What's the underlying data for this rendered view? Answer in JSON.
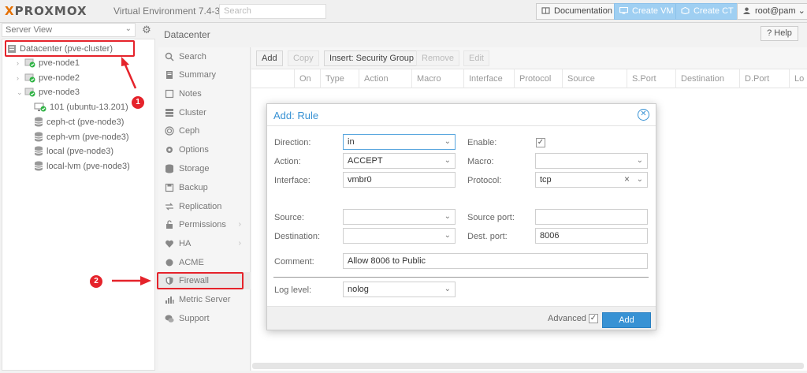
{
  "topbar": {
    "logo_x": "X",
    "logo_text": "PROXMOX",
    "version": "Virtual Environment 7.4-3",
    "search_placeholder": "Search",
    "documentation": "Documentation",
    "create_vm": "Create VM",
    "create_ct": "Create CT",
    "user": "root@pam"
  },
  "server_view": {
    "select_value": "Server View",
    "tree": [
      {
        "label": "Datacenter (pve-cluster)",
        "icon": "datacenter-icon"
      },
      {
        "label": "pve-node1",
        "icon": "node-icon"
      },
      {
        "label": "pve-node2",
        "icon": "node-icon"
      },
      {
        "label": "pve-node3",
        "icon": "node-icon"
      },
      {
        "label": "101 (ubuntu-13.201)",
        "icon": "vm-icon"
      },
      {
        "label": "ceph-ct (pve-node3)",
        "icon": "storage-icon"
      },
      {
        "label": "ceph-vm (pve-node3)",
        "icon": "storage-icon"
      },
      {
        "label": "local (pve-node3)",
        "icon": "storage-icon"
      },
      {
        "label": "local-lvm (pve-node3)",
        "icon": "storage-icon"
      }
    ]
  },
  "nav": {
    "title": "Datacenter",
    "help": "Help",
    "items": [
      {
        "label": "Search",
        "icon": "search-icon"
      },
      {
        "label": "Summary",
        "icon": "summary-icon"
      },
      {
        "label": "Notes",
        "icon": "notes-icon"
      },
      {
        "label": "Cluster",
        "icon": "cluster-icon"
      },
      {
        "label": "Ceph",
        "icon": "ceph-icon"
      },
      {
        "label": "Options",
        "icon": "gear-icon"
      },
      {
        "label": "Storage",
        "icon": "storage-icon"
      },
      {
        "label": "Backup",
        "icon": "backup-icon"
      },
      {
        "label": "Replication",
        "icon": "replication-icon"
      },
      {
        "label": "Permissions",
        "icon": "lock-icon"
      },
      {
        "label": "HA",
        "icon": "heartbeat-icon"
      },
      {
        "label": "ACME",
        "icon": "acme-icon"
      },
      {
        "label": "Firewall",
        "icon": "shield-icon"
      },
      {
        "label": "Metric Server",
        "icon": "chart-icon"
      },
      {
        "label": "Support",
        "icon": "support-icon"
      }
    ]
  },
  "toolbar": {
    "add": "Add",
    "copy": "Copy",
    "insert_sg": "Insert: Security Group",
    "remove": "Remove",
    "edit": "Edit"
  },
  "grid": {
    "columns": [
      "On",
      "Type",
      "Action",
      "Macro",
      "Interface",
      "Protocol",
      "Source",
      "S.Port",
      "Destination",
      "D.Port",
      "Lo"
    ]
  },
  "dialog": {
    "title": "Add: Rule",
    "direction_label": "Direction:",
    "direction_value": "in",
    "enable_label": "Enable:",
    "action_label": "Action:",
    "action_value": "ACCEPT",
    "macro_label": "Macro:",
    "macro_value": "",
    "interface_label": "Interface:",
    "interface_value": "vmbr0",
    "protocol_label": "Protocol:",
    "protocol_value": "tcp",
    "source_label": "Source:",
    "source_value": "",
    "source_port_label": "Source port:",
    "source_port_value": "",
    "destination_label": "Destination:",
    "destination_value": "",
    "dest_port_label": "Dest. port:",
    "dest_port_value": "8006",
    "comment_label": "Comment:",
    "comment_value": "Allow 8006 to Public",
    "log_level_label": "Log level:",
    "log_level_value": "nolog",
    "advanced_label": "Advanced",
    "add_button": "Add"
  },
  "annotations": {
    "badge1": "1",
    "badge2": "2"
  },
  "colors": {
    "accent": "#3892d4",
    "annotation_red": "#e5232b",
    "logo_orange": "#e57000",
    "node_green": "#2fb344"
  }
}
